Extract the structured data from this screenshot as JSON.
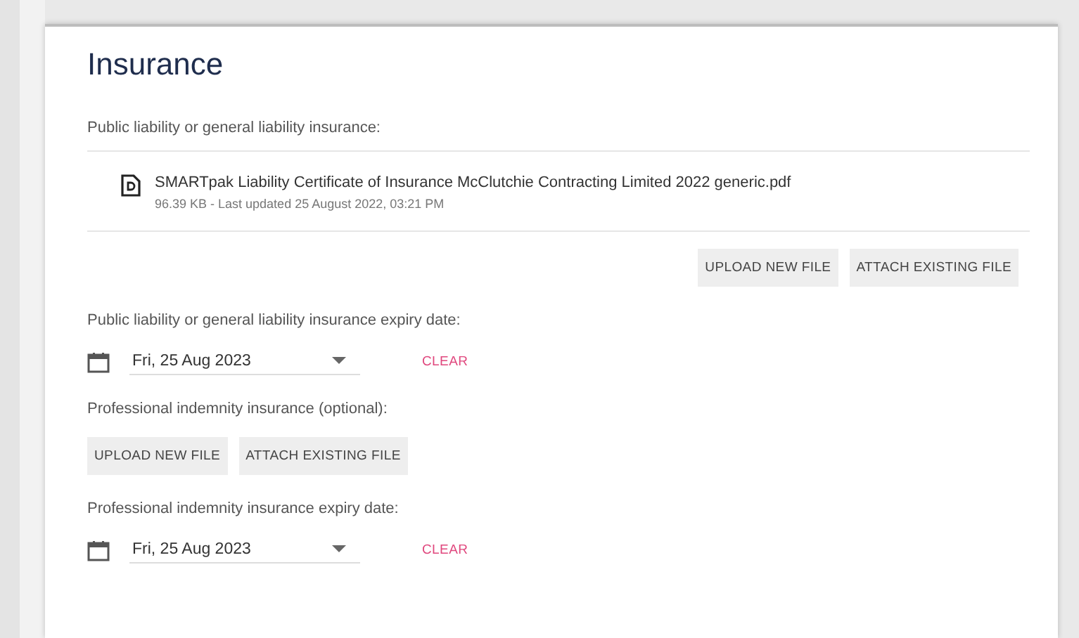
{
  "title": "Insurance",
  "sections": [
    {
      "kind": "file",
      "label": "Public liability or general liability insurance:",
      "file": {
        "name": "SMARTpak Liability Certificate of Insurance McClutchie Contracting Limited 2022 generic.pdf",
        "meta": "96.39 KB - Last updated 25 August 2022, 03:21 PM"
      },
      "buttons": [
        "UPLOAD NEW FILE",
        "ATTACH EXISTING FILE"
      ]
    },
    {
      "kind": "date",
      "label": "Public liability or general liability insurance expiry date:",
      "value": "Fri, 25 Aug 2023",
      "clear": "CLEAR"
    },
    {
      "kind": "upload",
      "label": "Professional indemnity insurance (optional):",
      "buttons": [
        "UPLOAD NEW FILE",
        "ATTACH EXISTING FILE"
      ]
    },
    {
      "kind": "date",
      "label": "Professional indemnity insurance expiry date:",
      "value": "Fri, 25 Aug 2023",
      "clear": "CLEAR"
    }
  ]
}
